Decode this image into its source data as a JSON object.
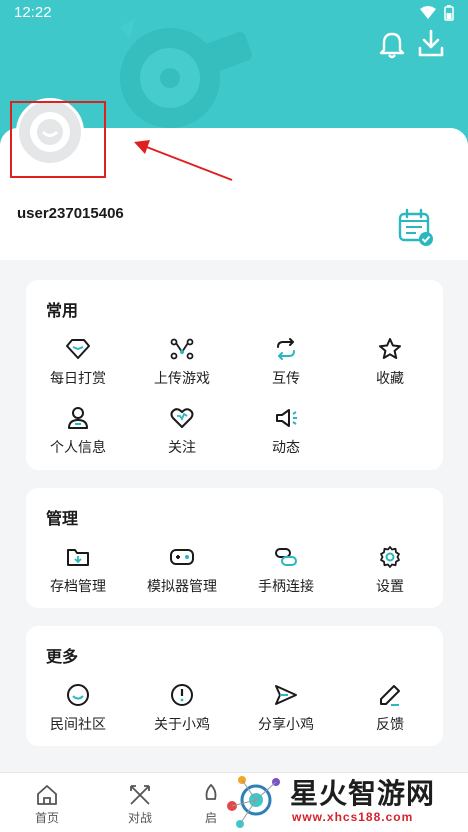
{
  "status": {
    "time": "12:22"
  },
  "header": {
    "icons": [
      "bell-icon",
      "download-icon"
    ],
    "accent": "#3ec8c9"
  },
  "profile": {
    "username": "user237015406"
  },
  "sections": {
    "common": {
      "title": "常用",
      "items": [
        {
          "label": "每日打赏",
          "icon": "diamond-icon"
        },
        {
          "label": "上传游戏",
          "icon": "nodes-icon"
        },
        {
          "label": "互传",
          "icon": "sync-icon"
        },
        {
          "label": "收藏",
          "icon": "star-icon"
        },
        {
          "label": "个人信息",
          "icon": "person-icon"
        },
        {
          "label": "关注",
          "icon": "heart-icon"
        },
        {
          "label": "动态",
          "icon": "speaker-icon"
        }
      ]
    },
    "manage": {
      "title": "管理",
      "items": [
        {
          "label": "存档管理",
          "icon": "folder-icon"
        },
        {
          "label": "模拟器管理",
          "icon": "gamepad-icon"
        },
        {
          "label": "手柄连接",
          "icon": "link-icon"
        },
        {
          "label": "设置",
          "icon": "gear-icon"
        }
      ]
    },
    "more": {
      "title": "更多",
      "items": [
        {
          "label": "民间社区",
          "icon": "smile-icon"
        },
        {
          "label": "关于小鸡",
          "icon": "info-icon"
        },
        {
          "label": "分享小鸡",
          "icon": "send-icon"
        },
        {
          "label": "反馈",
          "icon": "pencil-icon"
        }
      ]
    }
  },
  "bottom_nav": {
    "items": [
      {
        "label": "首页",
        "icon": "home-icon"
      },
      {
        "label": "对战",
        "icon": "swords-icon"
      },
      {
        "label": "启",
        "icon": "rocket-icon"
      }
    ]
  },
  "watermark": {
    "title": "星火智游网",
    "url": "www.xhcs188.com"
  }
}
